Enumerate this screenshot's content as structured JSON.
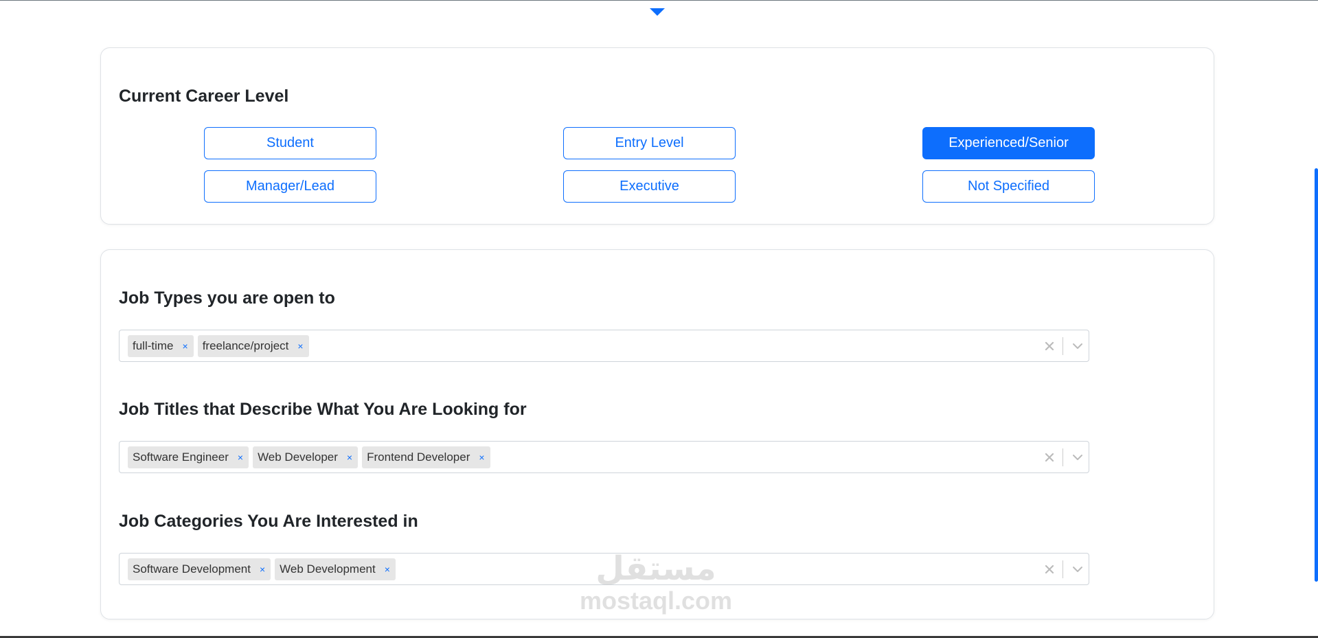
{
  "career_level": {
    "title": "Current Career Level",
    "options": [
      {
        "label": "Student",
        "selected": false
      },
      {
        "label": "Entry Level",
        "selected": false
      },
      {
        "label": "Experienced/Senior",
        "selected": true
      },
      {
        "label": "Manager/Lead",
        "selected": false
      },
      {
        "label": "Executive",
        "selected": false
      },
      {
        "label": "Not Specified",
        "selected": false
      }
    ]
  },
  "job_types": {
    "title": "Job Types you are open to",
    "tags": [
      "full-time",
      "freelance/project"
    ]
  },
  "job_titles": {
    "title": "Job Titles that Describe What You Are Looking for",
    "tags": [
      "Software Engineer",
      "Web Developer",
      "Frontend Developer"
    ]
  },
  "job_categories": {
    "title": "Job Categories You Are Interested in",
    "tags": [
      "Software Development",
      "Web Development"
    ]
  },
  "icons": {
    "remove": "×",
    "clear": "clear-icon",
    "dropdown": "chevron-down-icon",
    "collapse": "caret-down-icon"
  },
  "watermark": {
    "arabic": "مستقل",
    "latin": "mostaql.com"
  },
  "colors": {
    "accent": "#0d6efd",
    "tag_bg": "#e6e6e6",
    "border": "#ced4da"
  }
}
